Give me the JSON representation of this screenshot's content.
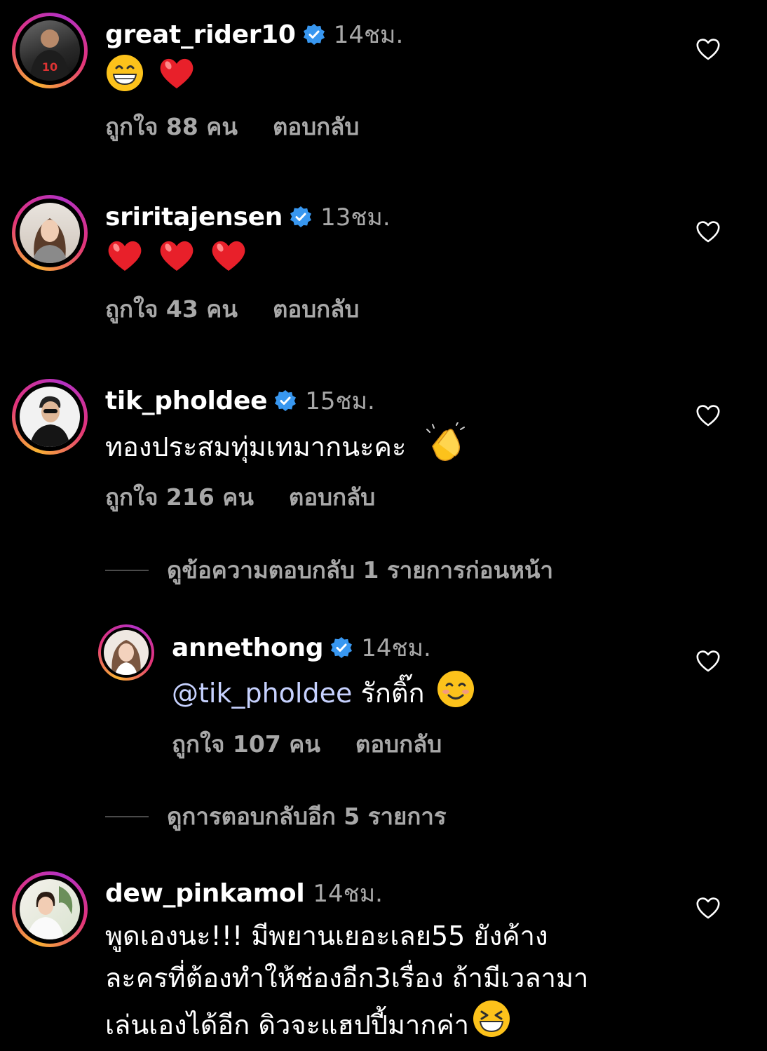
{
  "comments": [
    {
      "username": "great_rider10",
      "time": "14ชม.",
      "text": "",
      "likes": "ถูกใจ 88 คน",
      "reply": "ตอบกลับ"
    },
    {
      "username": "sriritajensen",
      "time": "13ชม.",
      "text": "",
      "likes": "ถูกใจ 43 คน",
      "reply": "ตอบกลับ"
    },
    {
      "username": "tik_pholdee",
      "time": "15ชม.",
      "text": "ทองประสมทุ่มเทมากนะคะ",
      "likes": "ถูกใจ 216 คน",
      "reply": "ตอบกลับ"
    },
    {
      "username": "dew_pinkamol",
      "time": "14ชม.",
      "lines": [
        "พูดเองนะ!!! มีพยานเยอะเลย55 ยังค้าง",
        "ละครที่ต้องทำให้ช่องอีก3เรื่อง ถ้ามีเวลามา",
        "เล่นเองได้อีก ดิวจะแฮปปี้มากค่า"
      ]
    }
  ],
  "reply_thread": {
    "view_previous": "ดูข้อความตอบกลับ 1 รายการก่อนหน้า",
    "reply": {
      "username": "annethong",
      "time": "14ชม.",
      "mention": "@tik_pholdee",
      "text": " รักติ๊ก",
      "likes": "ถูกใจ 107 คน",
      "reply": "ตอบกลับ"
    },
    "view_more": "ดูการตอบกลับอีก 5 รายการ"
  },
  "emoji_names": [
    "grinning-face",
    "red-heart",
    "clapping-hands",
    "smiling-face",
    "laughing-face"
  ],
  "colors": {
    "background": "#000000",
    "secondary_text": "#a8a8a8",
    "verified": "#3897f0",
    "ring_orange": "#f9b233",
    "ring_pink": "#e2337a"
  }
}
